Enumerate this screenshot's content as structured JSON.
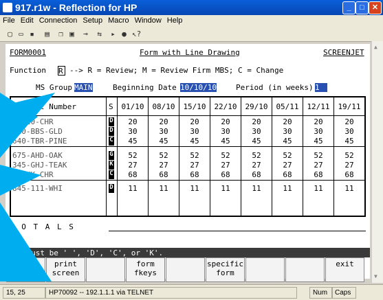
{
  "window": {
    "title": "917.r1w - Reflection for HP"
  },
  "menu": [
    "File",
    "Edit",
    "Connection",
    "Setup",
    "Macro",
    "Window",
    "Help"
  ],
  "screen": {
    "form_id": "FORM0001",
    "form_title": "Form with Line Drawing",
    "brand": "SCREENJET",
    "function_line": "Function",
    "function_value": "R",
    "function_help": "--> R = Review; M = Review Firm MBS; C = Change",
    "ms_group_label": "MS Group",
    "ms_group_value": "MAIN",
    "begin_date_label": "Beginning Date",
    "begin_date_value": "10/10/10",
    "period_label": "Period (in weeks)",
    "period_value": "1",
    "col_header_number": "t Number",
    "col_header_s": "S",
    "date_headers": [
      "01/10",
      "08/10",
      "15/10",
      "22/10",
      "29/10",
      "05/11",
      "12/11",
      "19/11"
    ],
    "rows": [
      {
        "num": "0-110-CHR",
        "code": "D",
        "vals": [
          "20",
          "20",
          "20",
          "20",
          "20",
          "20",
          "20",
          "20"
        ]
      },
      {
        "num": "420-BBS-GLD",
        "code": "D",
        "vals": [
          "30",
          "30",
          "30",
          "30",
          "30",
          "30",
          "30",
          "30"
        ]
      },
      {
        "num": "640-TBR-PINE",
        "code": "C",
        "vals": [
          "45",
          "45",
          "45",
          "45",
          "45",
          "45",
          "45",
          "45"
        ]
      },
      {
        "num": "675-AHD-OAK",
        "code": "G",
        "vals": [
          "52",
          "52",
          "52",
          "52",
          "52",
          "52",
          "52",
          "52"
        ]
      },
      {
        "num": "345-GHJ-TEAK",
        "code": "K",
        "vals": [
          "27",
          "27",
          "27",
          "27",
          "27",
          "27",
          "27",
          "27"
        ]
      },
      {
        "num": "2-GHK-CHR",
        "code": "C",
        "vals": [
          "68",
          "68",
          "68",
          "68",
          "68",
          "68",
          "68",
          "68"
        ]
      },
      {
        "num": "845-111-WHI",
        "code": "D",
        "vals": [
          "11",
          "11",
          "11",
          "11",
          "11",
          "11",
          "11",
          "11"
        ]
      }
    ],
    "totals_label": "T O T A L S",
    "error_msg": "ale must be ' ', 'D', 'C', or 'K'."
  },
  "function_keys": [
    {
      "label": "print\nform"
    },
    {
      "label": "print\nscreen"
    },
    {
      "label": ""
    },
    {
      "label": "form\nfkeys"
    },
    {
      "label": ""
    },
    {
      "label": "specific\nform"
    },
    {
      "label": ""
    },
    {
      "label": ""
    },
    {
      "label": "exit"
    }
  ],
  "status": {
    "cursor": "15, 25",
    "connection": "HP70092 -- 192.1.1.1 via TELNET",
    "num": "Num",
    "caps": "Caps"
  },
  "colors": {
    "overlay": "#00aef0",
    "titlebar": "#0646b4"
  }
}
